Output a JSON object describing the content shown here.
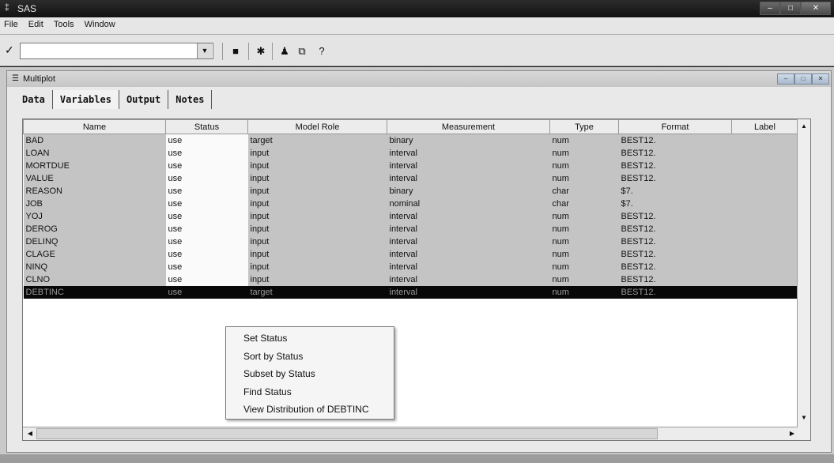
{
  "window": {
    "title": "SAS",
    "app_icon": "sas-icon"
  },
  "menubar": {
    "items": [
      "File",
      "Edit",
      "Tools",
      "Window"
    ]
  },
  "toolbar": {
    "command_value": "",
    "icons": [
      "checkmark-icon",
      "save-icon",
      "run-icon",
      "user-icon",
      "windows-icon",
      "help-icon"
    ]
  },
  "child_window": {
    "title": "Multiplot",
    "tabs": [
      "Data",
      "Variables",
      "Output",
      "Notes"
    ],
    "active_tab": "Variables"
  },
  "table": {
    "columns": [
      "Name",
      "Status",
      "Model Role",
      "Measurement",
      "Type",
      "Format",
      "Label"
    ],
    "rows": [
      [
        "BAD",
        "use",
        "target",
        "binary",
        "num",
        "BEST12.",
        ""
      ],
      [
        "LOAN",
        "use",
        "input",
        "interval",
        "num",
        "BEST12.",
        ""
      ],
      [
        "MORTDUE",
        "use",
        "input",
        "interval",
        "num",
        "BEST12.",
        ""
      ],
      [
        "VALUE",
        "use",
        "input",
        "interval",
        "num",
        "BEST12.",
        ""
      ],
      [
        "REASON",
        "use",
        "input",
        "binary",
        "char",
        "$7.",
        ""
      ],
      [
        "JOB",
        "use",
        "input",
        "nominal",
        "char",
        "$7.",
        ""
      ],
      [
        "YOJ",
        "use",
        "input",
        "interval",
        "num",
        "BEST12.",
        ""
      ],
      [
        "DEROG",
        "use",
        "input",
        "interval",
        "num",
        "BEST12.",
        ""
      ],
      [
        "DELINQ",
        "use",
        "input",
        "interval",
        "num",
        "BEST12.",
        ""
      ],
      [
        "CLAGE",
        "use",
        "input",
        "interval",
        "num",
        "BEST12.",
        ""
      ],
      [
        "NINQ",
        "use",
        "input",
        "interval",
        "num",
        "BEST12.",
        ""
      ],
      [
        "CLNO",
        "use",
        "input",
        "interval",
        "num",
        "BEST12.",
        ""
      ],
      [
        "DEBTINC",
        "use",
        "target",
        "interval",
        "num",
        "BEST12.",
        ""
      ]
    ],
    "selected_row": 12
  },
  "context_menu": {
    "items": [
      "Set Status",
      "Sort by Status",
      "Subset by Status",
      "Find Status",
      "View Distribution of DEBTINC"
    ]
  },
  "colors": {
    "selected_row_bg": "#080808",
    "grid_row_bg": "#c4c4c4"
  }
}
